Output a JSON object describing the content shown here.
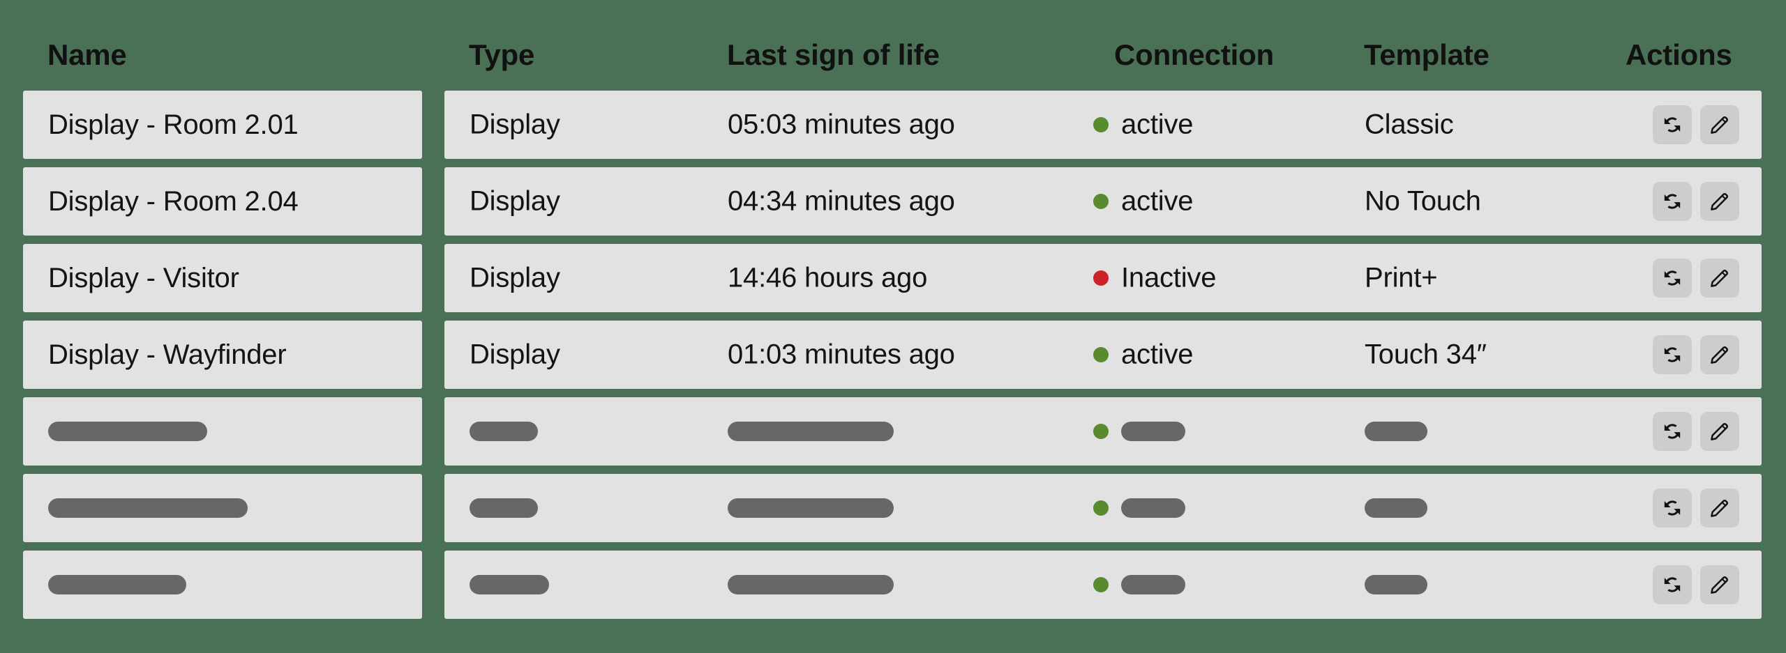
{
  "theme": {
    "background": "#4a7055",
    "card_background": "#e2e2e2",
    "text": "#141414",
    "icon_button_background": "#cdcdcd",
    "status_active": "#5a8a2e",
    "status_inactive": "#cc2229",
    "skeleton": "#676767"
  },
  "table": {
    "columns": [
      {
        "key": "name",
        "label": "Name"
      },
      {
        "key": "type",
        "label": "Type"
      },
      {
        "key": "last",
        "label": "Last sign of life"
      },
      {
        "key": "connection",
        "label": "Connection"
      },
      {
        "key": "template",
        "label": "Template"
      },
      {
        "key": "actions",
        "label": "Actions"
      }
    ],
    "rows": [
      {
        "name": "Display - Room 2.01",
        "type": "Display",
        "last_sign_of_life": "05:03 minutes ago",
        "connection": "active",
        "connection_state": "active",
        "template": "Classic",
        "loading": false
      },
      {
        "name": "Display - Room 2.04",
        "type": "Display",
        "last_sign_of_life": "04:34 minutes ago",
        "connection": "active",
        "connection_state": "active",
        "template": "No Touch",
        "loading": false
      },
      {
        "name": "Display - Visitor",
        "type": "Display",
        "last_sign_of_life": "14:46 hours ago",
        "connection": "Inactive",
        "connection_state": "inactive",
        "template": "Print+",
        "loading": false
      },
      {
        "name": "Display - Wayfinder",
        "type": "Display",
        "last_sign_of_life": "01:03 minutes ago",
        "connection": "active",
        "connection_state": "active",
        "template": "Touch 34″",
        "loading": false
      },
      {
        "name": "",
        "type": "",
        "last_sign_of_life": "",
        "connection": "",
        "connection_state": "active",
        "template": "",
        "loading": true,
        "skeleton_widths": {
          "name": 228,
          "type": 98,
          "last": 238,
          "conn": 92,
          "tmpl": 90
        }
      },
      {
        "name": "",
        "type": "",
        "last_sign_of_life": "",
        "connection": "",
        "connection_state": "active",
        "template": "",
        "loading": true,
        "skeleton_widths": {
          "name": 286,
          "type": 98,
          "last": 238,
          "conn": 92,
          "tmpl": 90
        }
      },
      {
        "name": "",
        "type": "",
        "last_sign_of_life": "",
        "connection": "",
        "connection_state": "active",
        "template": "",
        "loading": true,
        "skeleton_widths": {
          "name": 198,
          "type": 114,
          "last": 238,
          "conn": 92,
          "tmpl": 90
        }
      }
    ],
    "row_actions": [
      {
        "key": "refresh",
        "icon": "refresh-icon",
        "label": "Refresh"
      },
      {
        "key": "edit",
        "icon": "pencil-icon",
        "label": "Edit"
      }
    ]
  }
}
